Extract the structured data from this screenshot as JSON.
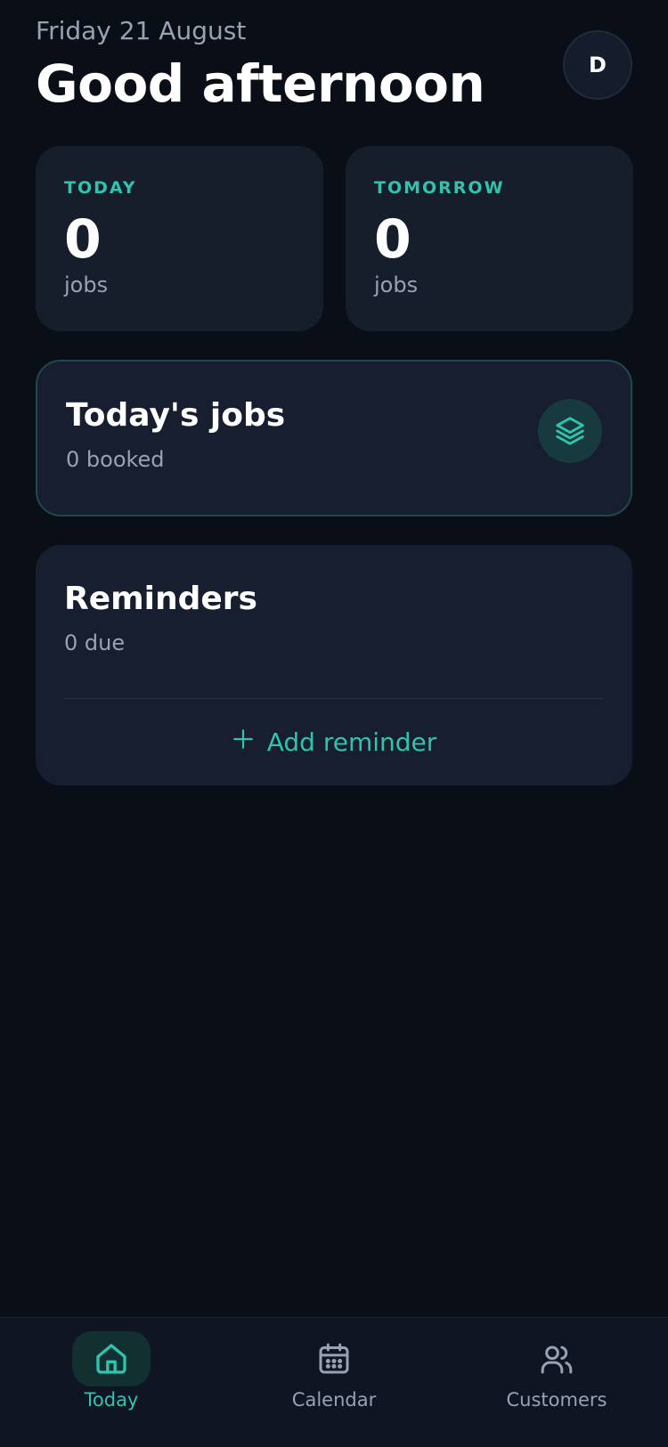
{
  "header": {
    "date": "Friday 21 August",
    "greeting": "Good afternoon",
    "avatar_initial": "D"
  },
  "stats": [
    {
      "label": "TODAY",
      "value": "0",
      "unit": "jobs"
    },
    {
      "label": "TOMORROW",
      "value": "0",
      "unit": "jobs"
    }
  ],
  "jobs_card": {
    "title": "Today's jobs",
    "subtitle": "0 booked",
    "icon": "layers-icon"
  },
  "reminders": {
    "title": "Reminders",
    "subtitle": "0 due",
    "add_label": "Add reminder"
  },
  "nav": {
    "items": [
      {
        "label": "Today",
        "icon": "home-icon",
        "active": true
      },
      {
        "label": "Calendar",
        "icon": "calendar-icon",
        "active": false
      },
      {
        "label": "Customers",
        "icon": "users-icon",
        "active": false
      }
    ]
  },
  "colors": {
    "background": "#0a0e17",
    "card": "#161e2c",
    "accent": "#2ec4b0",
    "muted": "#98a2b3",
    "text": "#ffffff"
  }
}
